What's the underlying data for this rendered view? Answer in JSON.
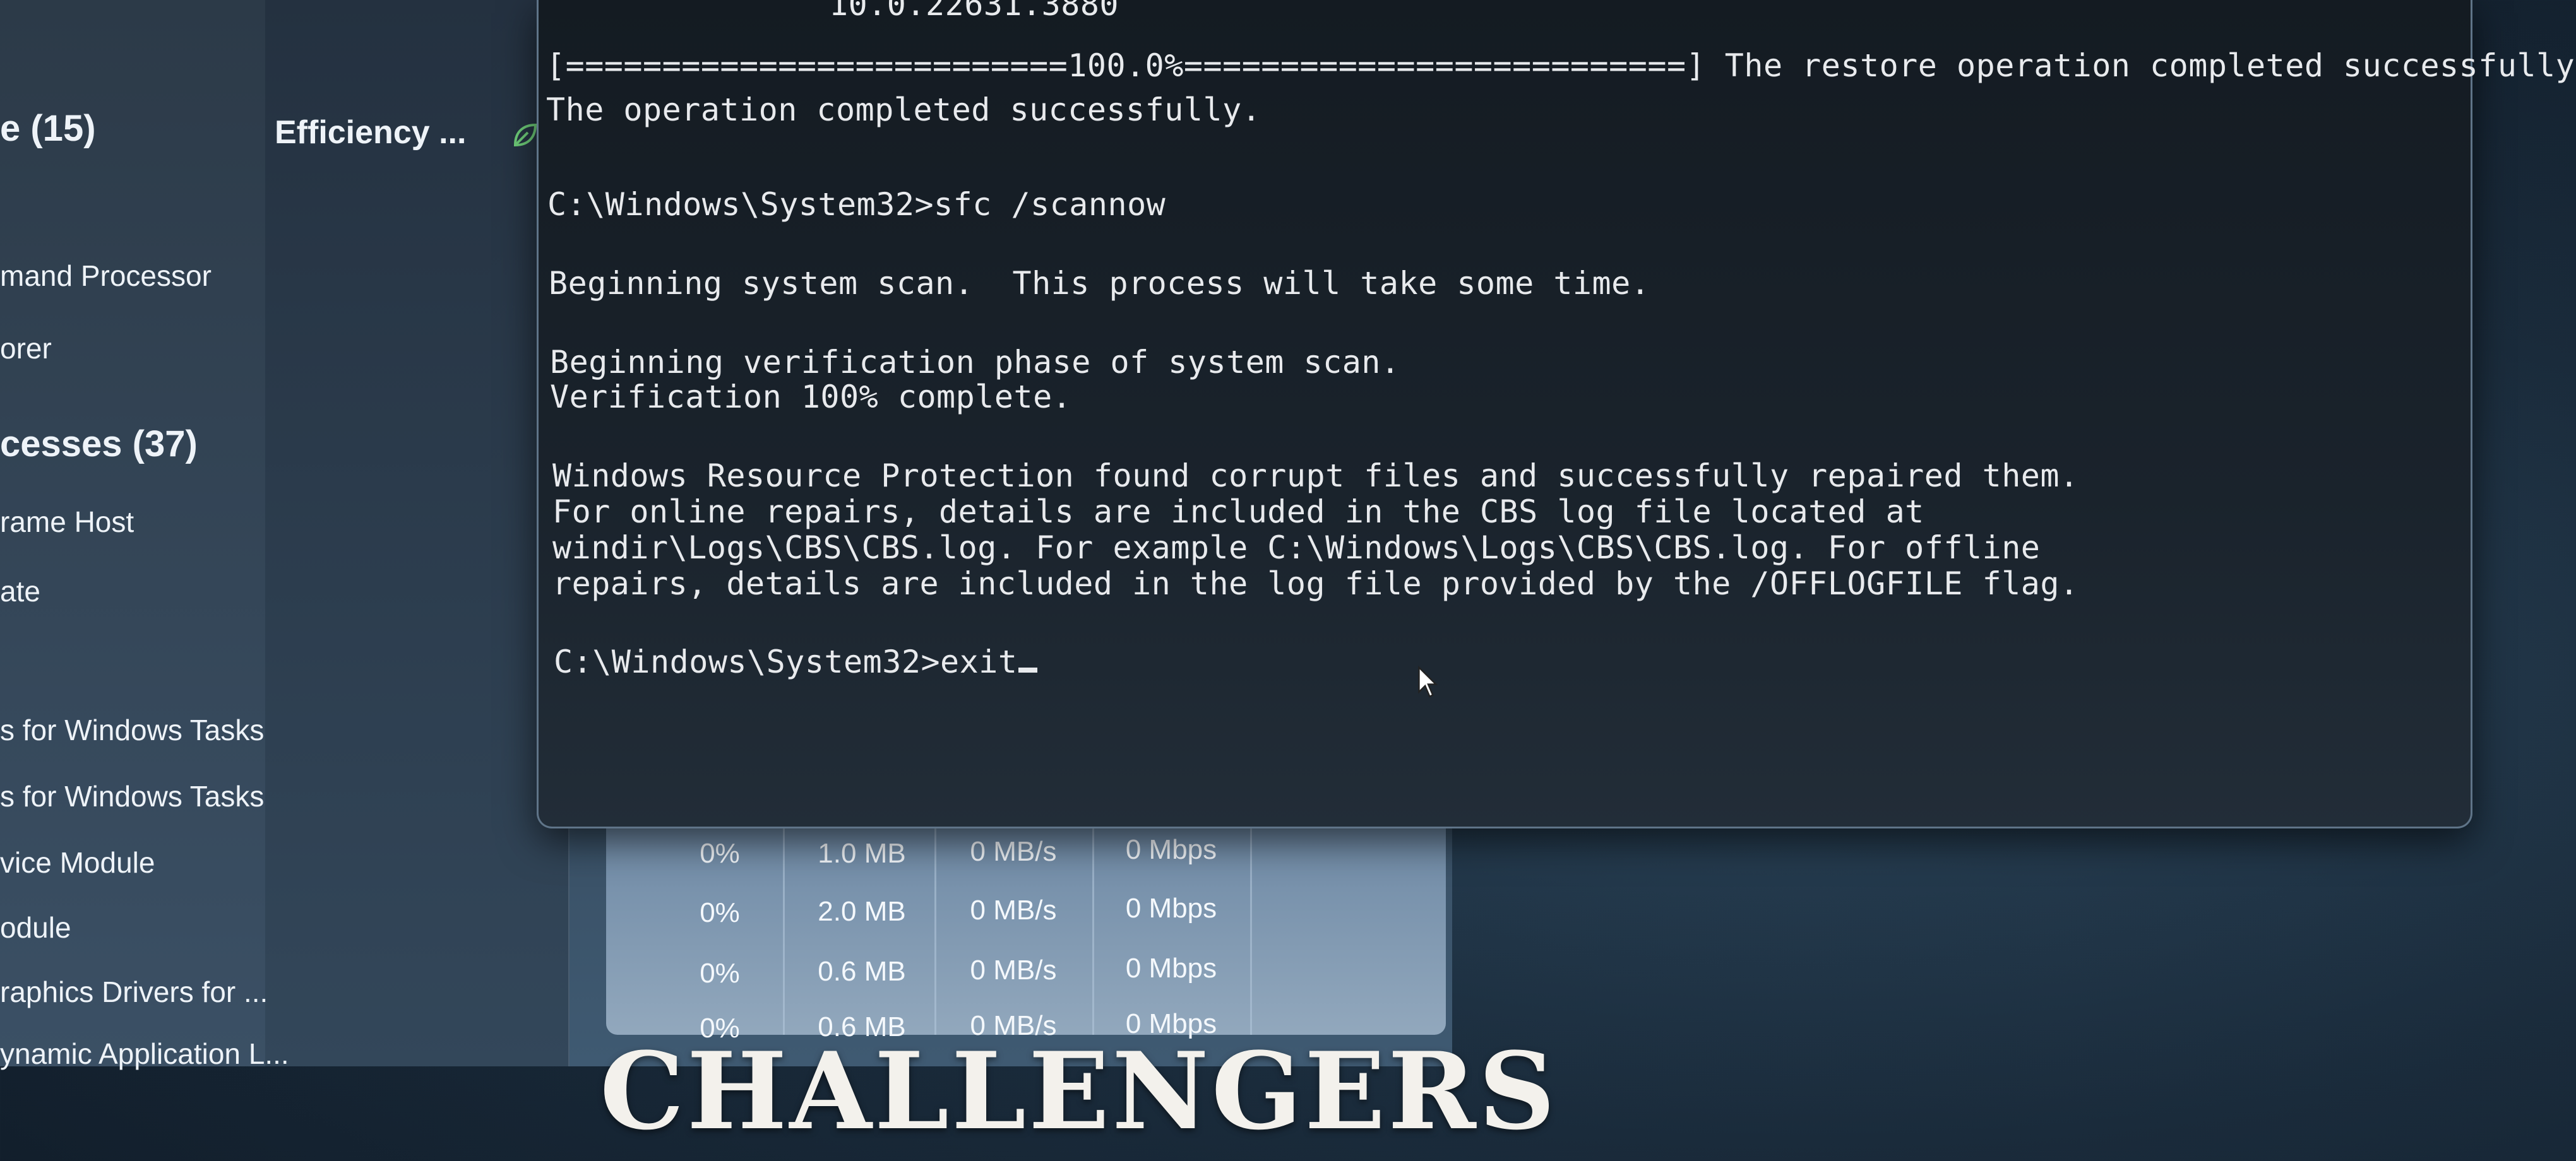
{
  "task_manager": {
    "group_apps": "e (15)",
    "status_header": "Efficiency ...",
    "rows": [
      {
        "name": "mand Processor"
      },
      {
        "name": "orer"
      },
      {
        "name": "cesses (37)",
        "group": true
      },
      {
        "name": "rame Host"
      },
      {
        "name": "ate"
      },
      {
        "name": "s for Windows Tasks"
      },
      {
        "name": "s for Windows Tasks"
      },
      {
        "name": "vice Module"
      },
      {
        "name": "odule"
      },
      {
        "name": "raphics Drivers for ..."
      },
      {
        "name": "ynamic Application L..."
      }
    ],
    "metrics": [
      {
        "cpu": "0%",
        "memory": "1.0 MB",
        "disk": "0 MB/s",
        "network": "0 Mbps"
      },
      {
        "cpu": "0%",
        "memory": "2.0 MB",
        "disk": "0 MB/s",
        "network": "0 Mbps"
      },
      {
        "cpu": "0%",
        "memory": "0.6 MB",
        "disk": "0 MB/s",
        "network": "0 Mbps"
      },
      {
        "cpu": "0%",
        "memory": "0.6 MB",
        "disk": "0 MB/s",
        "network": "0 Mbps"
      }
    ]
  },
  "cmd": {
    "top_partial": "10.0.22631.3880",
    "progress_line": "[==========================100.0%==========================]",
    "restore_msg": " The restore operation completed successfully.",
    "op_complete": "The operation completed successfully.",
    "prompt_1": "C:\\Windows\\System32>sfc /scannow",
    "scan_begin": "Beginning system scan.  This process will take some time.",
    "verify_begin": "Beginning verification phase of system scan.",
    "verify_done": "Verification 100% complete.",
    "wrp_1": "Windows Resource Protection found corrupt files and successfully repaired them.",
    "wrp_2": "For online repairs, details are included in the CBS log file located at",
    "wrp_3": "windir\\Logs\\CBS\\CBS.log. For example C:\\Windows\\Logs\\CBS\\CBS.log. For offline",
    "wrp_4": "repairs, details are included in the log file provided by the /OFFLOGFILE flag.",
    "prompt_2": "C:\\Windows\\System32>exit"
  },
  "banner": {
    "text": "CHALLENGERS"
  },
  "colors": {
    "terminal_text": "#e8eaed",
    "restore_text": "#e8b49a",
    "terminal_bg": "#141b22"
  }
}
